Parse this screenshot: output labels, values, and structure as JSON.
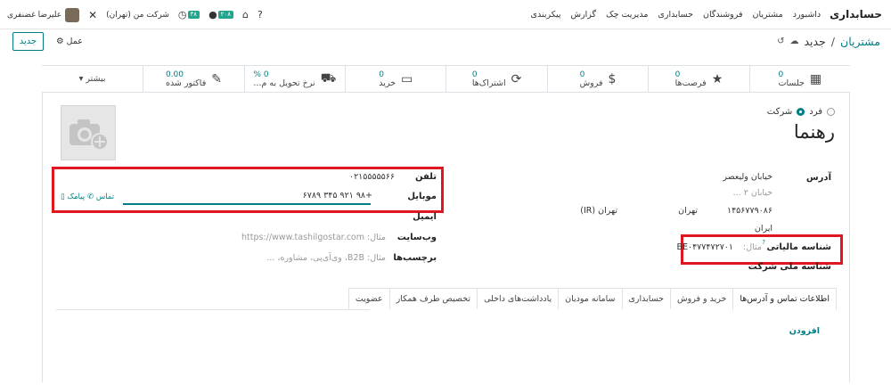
{
  "navbar": {
    "brand": "حسابداری",
    "menu": [
      "داشبورد",
      "مشتریان",
      "فروشندگان",
      "حسابداری",
      "مدیریت چک",
      "گزارش",
      "پیکربندی"
    ],
    "user_name": "علیرضا غضنفری",
    "company": "شرکت من (تهران)",
    "activity_badge": "۳۸",
    "chat_badge": "۲۰۸"
  },
  "control": {
    "breadcrumb_parent": "مشتریان",
    "breadcrumb_sep": "/",
    "breadcrumb_current": "جدید",
    "new_button": "جدید",
    "action_label": "عمل"
  },
  "smart_buttons": [
    {
      "icon": "calendar-icon",
      "glyph": "▦",
      "value": "0",
      "label": "جلسات"
    },
    {
      "icon": "star-icon",
      "glyph": "★",
      "value": "0",
      "label": "فرصت‌ها"
    },
    {
      "icon": "dollar-icon",
      "glyph": "$",
      "value": "0",
      "label": "فروش"
    },
    {
      "icon": "refresh-icon",
      "glyph": "⟳",
      "value": "0",
      "label": "اشتراک‌ها"
    },
    {
      "icon": "credit-card-icon",
      "glyph": "▭",
      "value": "0",
      "label": "خرید"
    },
    {
      "icon": "truck-icon",
      "glyph": "⛟",
      "value": "0 %",
      "label": "نرخ تحویل به م..."
    },
    {
      "icon": "edit-icon",
      "glyph": "✎",
      "value": "0.00",
      "label": "فاکتور شده"
    }
  ],
  "more_label": "بیشتر ▾",
  "form": {
    "type_person": "فرد",
    "type_company": "شرکت",
    "partner_name": "رهنما",
    "address_label": "آدرس",
    "street": "خیابان ولیعصر",
    "street2_placeholder": "خیابان ۲ ...",
    "zip": "۱۴۵۶۷۷۹۰۸۶",
    "city": "تهران",
    "state": "تهران (IR)",
    "country": "ایران",
    "tax_id_label": "شناسه مالیاتی",
    "tax_id_hint": "?",
    "tax_id_value": "BE۰۴۷۷۴۷۲۷۰۱",
    "tax_id_example": "مثال:",
    "national_id_label": "شناسه ملی شرکت",
    "phone_label": "تلفن",
    "phone_value": "۰۲۱۵۵۵۵۵۶۶",
    "mobile_label": "موبایل",
    "mobile_value": "+۹۸ ۹۲۱ ۳۴۵ ۶۷۸۹",
    "call_link": "تماس",
    "sms_link": "پیامک",
    "email_label": "ایمیل",
    "website_label": "وب‌سایت",
    "website_placeholder": "مثال: https://www.tashilgostar.com",
    "tags_label": "برچسب‌ها",
    "tags_placeholder": "مثال: B2B، وی‌آی‌پی، مشاوره، ..."
  },
  "tabs": [
    "اطلاعات تماس و آدرس‌ها",
    "خرید و فروش",
    "حسابداری",
    "سامانه مودیان",
    "یادداشت‌های داخلی",
    "تخصیص طرف همکار",
    "عضویت"
  ],
  "add_link": "افزودن",
  "colors": {
    "accent": "#017e84",
    "highlight": "#e0171f",
    "badge": "#21a58d"
  }
}
